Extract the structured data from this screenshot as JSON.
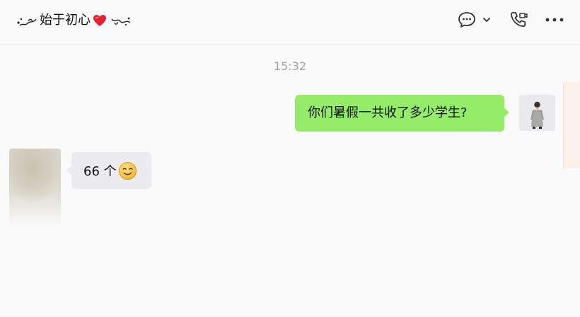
{
  "header": {
    "title": "始于初心",
    "title_icon_left": "flourish-left-icon",
    "title_icon_heart": "heart-icon",
    "title_icon_right": "flourish-right-icon",
    "tools": [
      {
        "name": "chat-bubble-icon"
      },
      {
        "name": "chevron-down-icon"
      },
      {
        "name": "video-call-icon"
      },
      {
        "name": "more-icon"
      }
    ]
  },
  "conversation": {
    "timestamp": "15:32",
    "messages": [
      {
        "side": "right",
        "text": "你们暑假一共收了多少学生?",
        "bubble_color": "#95ec69"
      },
      {
        "side": "left",
        "text": "66 个",
        "emoji": "smiling-face-icon",
        "bubble_color": "#ececf0"
      }
    ]
  },
  "colors": {
    "background": "#fafafa",
    "timestamp": "#a3a3a3",
    "sent_bubble": "#95ec69",
    "received_bubble": "#ececf0"
  }
}
